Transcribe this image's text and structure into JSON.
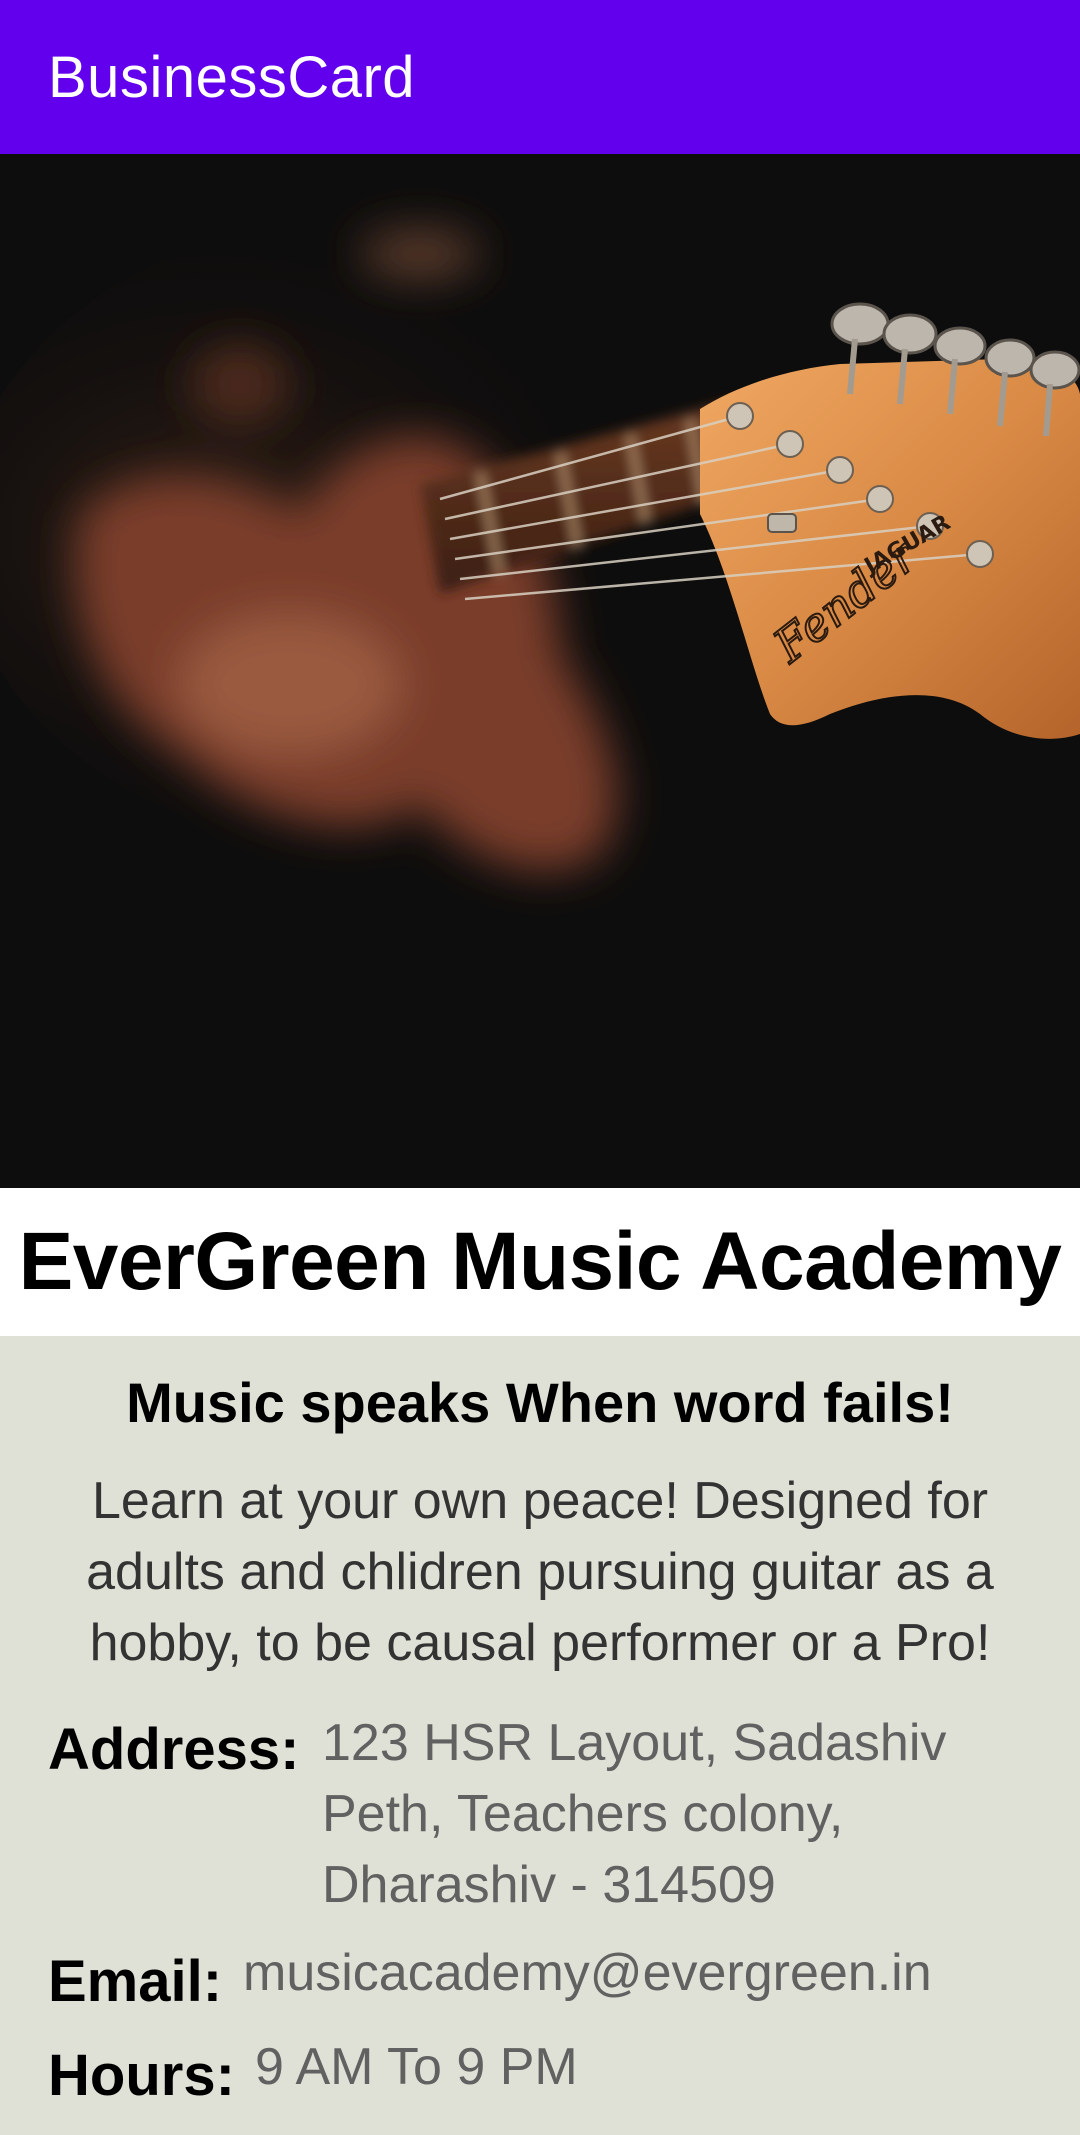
{
  "appbar": {
    "title": "BusinessCard",
    "color": "#6200ee"
  },
  "hero": {
    "image_description_icon": "guitar-headstock-photo"
  },
  "business": {
    "name": "EverGreen Music Academy",
    "tagline": "Music speaks When word fails!",
    "description": "Learn at your own peace! Designed for adults and chlidren pursuing guitar as a hobby, to be causal performer or a Pro!"
  },
  "info": {
    "address_label": "Address:",
    "address_value": "123 HSR Layout, Sadashiv Peth, Teachers colony, Dharashiv - 314509",
    "email_label": "Email:",
    "email_value": "musicacademy@evergreen.in",
    "hours_label": "Hours:",
    "hours_value": "9 AM To 9 PM"
  }
}
